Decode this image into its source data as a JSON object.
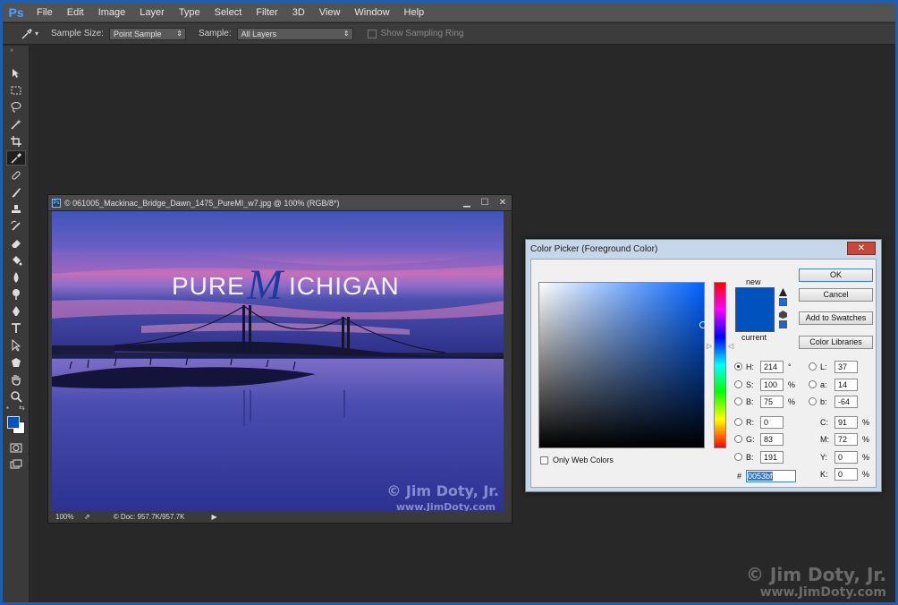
{
  "app": {
    "logo": "Ps"
  },
  "menu": [
    "File",
    "Edit",
    "Image",
    "Layer",
    "Type",
    "Select",
    "Filter",
    "3D",
    "View",
    "Window",
    "Help"
  ],
  "options_bar": {
    "sample_size_label": "Sample Size:",
    "sample_size_value": "Point Sample",
    "sample_label": "Sample:",
    "sample_value": "All Layers",
    "show_ring_label": "Show Sampling Ring"
  },
  "toolbar": {
    "tools": [
      "move-icon",
      "marquee-icon",
      "lasso-icon",
      "magic-wand-icon",
      "crop-icon",
      "eyedropper-icon",
      "healing-brush-icon",
      "brush-icon",
      "clone-stamp-icon",
      "history-brush-icon",
      "eraser-icon",
      "paint-bucket-icon",
      "blur-icon",
      "dodge-icon",
      "pen-icon",
      "type-icon",
      "path-selection-icon",
      "shape-icon",
      "hand-icon",
      "zoom-icon"
    ],
    "foreground_color": "#0053bf",
    "background_color": "#ffffff"
  },
  "document": {
    "title": "© 061005_Mackinac_Bridge_Dawn_1475_PureMI_w7.jpg @ 100% (RGB/8*)",
    "zoom": "100%",
    "doc_size": "Doc: 957.7K/957.7K",
    "image_text": {
      "pure": "PURE",
      "m": "M",
      "ichigan": "ICHIGAN"
    },
    "watermark_line1": "© Jim Doty, Jr.",
    "watermark_line2": "www.JimDoty.com"
  },
  "color_picker": {
    "title": "Color Picker (Foreground Color)",
    "close": "✕",
    "new_label": "new",
    "current_label": "current",
    "new_color": "#0053bf",
    "buttons": {
      "ok": "OK",
      "cancel": "Cancel",
      "add_swatches": "Add to Swatches",
      "libraries": "Color Libraries"
    },
    "only_web_colors": "Only Web Colors",
    "hsb": [
      {
        "label": "H:",
        "value": "214",
        "unit": "°",
        "selected": true
      },
      {
        "label": "S:",
        "value": "100",
        "unit": "%",
        "selected": false
      },
      {
        "label": "B:",
        "value": "75",
        "unit": "%",
        "selected": false
      }
    ],
    "rgb": [
      {
        "label": "R:",
        "value": "0"
      },
      {
        "label": "G:",
        "value": "83"
      },
      {
        "label": "B:",
        "value": "191"
      }
    ],
    "lab": [
      {
        "label": "L:",
        "value": "37"
      },
      {
        "label": "a:",
        "value": "14"
      },
      {
        "label": "b:",
        "value": "-64"
      }
    ],
    "cmyk": [
      {
        "label": "C:",
        "value": "91",
        "unit": "%"
      },
      {
        "label": "M:",
        "value": "72",
        "unit": "%"
      },
      {
        "label": "Y:",
        "value": "0",
        "unit": "%"
      },
      {
        "label": "K:",
        "value": "0",
        "unit": "%"
      }
    ],
    "hex_label": "#",
    "hex": "0053bf"
  },
  "watermark": {
    "line1": "© Jim Doty, Jr.",
    "line2": "www.JimDoty.com"
  }
}
